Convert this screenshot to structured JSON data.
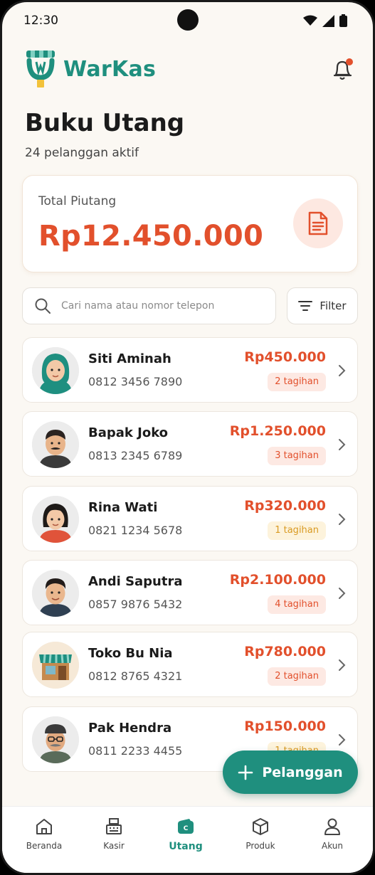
{
  "status_bar": {
    "time": "12:30"
  },
  "brand": {
    "name": "WarKas",
    "color": "#1f8f7e"
  },
  "page": {
    "title": "Buku Utang",
    "subtitle": "24 pelanggan aktif"
  },
  "summary": {
    "label": "Total Piutang",
    "amount": "Rp12.450.000",
    "accent": "#e2502c"
  },
  "search": {
    "placeholder": "Cari nama atau nomor telepon"
  },
  "filter": {
    "label": "Filter"
  },
  "customers": [
    {
      "name": "Siti Aminah",
      "phone": "0812 3456 7890",
      "amount": "Rp450.000",
      "bills": "2 tagihan",
      "badge": "red",
      "avatar": "hijab-woman"
    },
    {
      "name": "Bapak Joko",
      "phone": "0813 2345 6789",
      "amount": "Rp1.250.000",
      "bills": "3 tagihan",
      "badge": "red",
      "avatar": "mustache-man"
    },
    {
      "name": "Rina Wati",
      "phone": "0821 1234 5678",
      "amount": "Rp320.000",
      "bills": "1 tagihan",
      "badge": "yellow",
      "avatar": "woman"
    },
    {
      "name": "Andi Saputra",
      "phone": "0857 9876 5432",
      "amount": "Rp2.100.000",
      "bills": "4 tagihan",
      "badge": "red",
      "avatar": "young-man"
    },
    {
      "name": "Toko Bu Nia",
      "phone": "0812 8765 4321",
      "amount": "Rp780.000",
      "bills": "2 tagihan",
      "badge": "red",
      "avatar": "shop"
    },
    {
      "name": "Pak Hendra",
      "phone": "0811 2233 4455",
      "amount": "Rp150.000",
      "bills": "1 tagihan",
      "badge": "yellow",
      "avatar": "older-man"
    }
  ],
  "fab": {
    "label": "Pelanggan"
  },
  "nav": [
    {
      "label": "Beranda",
      "icon": "home-icon"
    },
    {
      "label": "Kasir",
      "icon": "cash-register-icon"
    },
    {
      "label": "Utang",
      "icon": "wallet-icon",
      "active": true
    },
    {
      "label": "Produk",
      "icon": "box-icon"
    },
    {
      "label": "Akun",
      "icon": "user-icon"
    }
  ]
}
